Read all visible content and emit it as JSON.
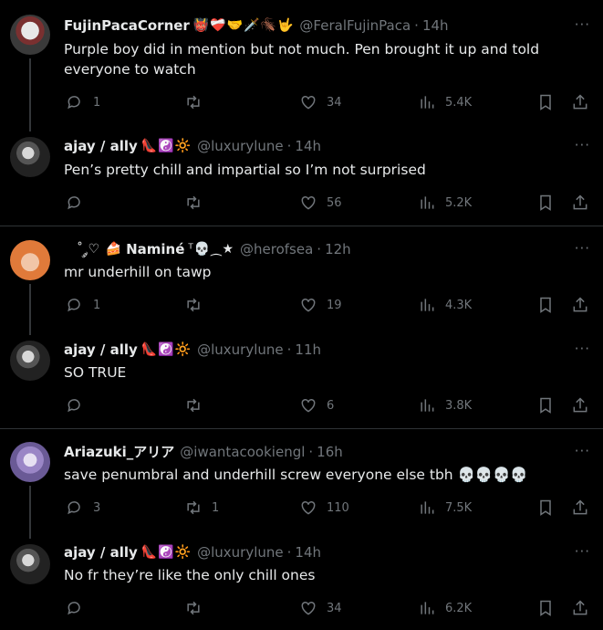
{
  "tweets": [
    {
      "name": "FujinPacaCorner",
      "emoji": "👹❤️‍🩹🤝🗡️🪳🤟",
      "handle": "@FeralFujinPaca",
      "time": "14h",
      "text": "Purple boy did in mention but not much. Pen brought it up and told everyone to watch",
      "replies": "1",
      "retweets": "",
      "likes": "34",
      "views": "5.4K"
    },
    {
      "name": "ajay / ally",
      "emoji": "👠☯️🔆",
      "handle": "@luxurylune",
      "time": "14h",
      "text": "Pen’s pretty chill and impartial so I’m not surprised",
      "replies": "",
      "retweets": "",
      "likes": "56",
      "views": "5.2K"
    },
    {
      "name": "Naminé",
      "prefix": "˚ ༘♡ 🍰",
      "emoji": "ᵀ💀⁔★",
      "handle": "@herofsea",
      "time": "12h",
      "text": "mr underhill on tawp",
      "replies": "1",
      "retweets": "",
      "likes": "19",
      "views": "4.3K"
    },
    {
      "name": "ajay / ally",
      "emoji": "👠☯️🔆",
      "handle": "@luxurylune",
      "time": "11h",
      "text": "SO TRUE",
      "replies": "",
      "retweets": "",
      "likes": "6",
      "views": "3.8K"
    },
    {
      "name": "Ariazuki_アリア",
      "emoji": "",
      "handle": "@iwantacookiengl",
      "time": "16h",
      "text": "save penumbral and underhill screw everyone else tbh 💀💀💀💀",
      "replies": "3",
      "retweets": "1",
      "likes": "110",
      "views": "7.5K"
    },
    {
      "name": "ajay / ally",
      "emoji": "👠☯️🔆",
      "handle": "@luxurylune",
      "time": "14h",
      "text": "No fr they’re like the only chill ones",
      "replies": "",
      "retweets": "",
      "likes": "34",
      "views": "6.2K"
    }
  ],
  "ui": {
    "dot": "·",
    "more": "···"
  }
}
